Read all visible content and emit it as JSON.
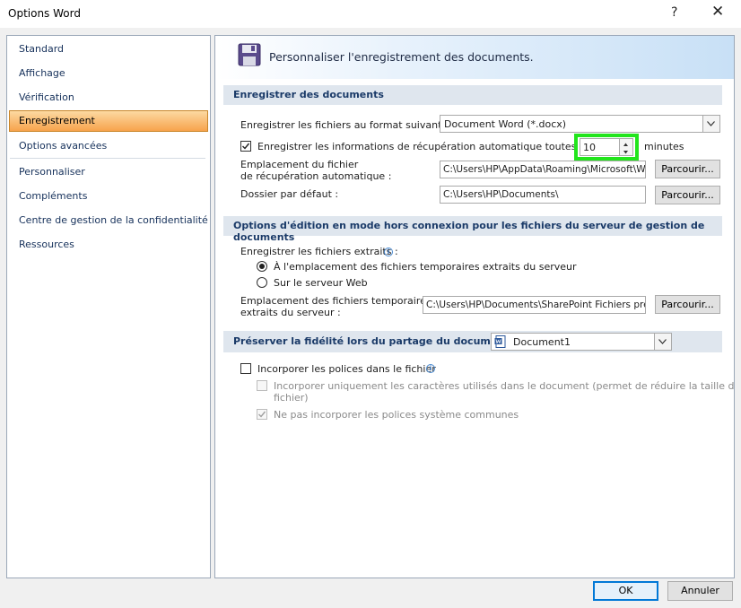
{
  "window": {
    "title": "Options Word",
    "help_glyph": "?",
    "close_glyph": "✕"
  },
  "sidebar": {
    "items": [
      {
        "label": "Standard"
      },
      {
        "label": "Affichage"
      },
      {
        "label": "Vérification"
      },
      {
        "label": "Enregistrement",
        "selected": true
      },
      {
        "label": "Options avancées"
      },
      {
        "label": "Personnaliser"
      },
      {
        "label": "Compléments"
      },
      {
        "label": "Centre de gestion de la confidentialité"
      },
      {
        "label": "Ressources"
      }
    ]
  },
  "banner": {
    "title": "Personnaliser l'enregistrement des documents.",
    "icon": "floppy-disk-icon"
  },
  "save_section": {
    "header": "Enregistrer des documents",
    "format_label": "Enregistrer les fichiers au format suivant :",
    "format_value": "Document Word (*.docx)",
    "autorecover_label": "Enregistrer les informations de récupération automatique toutes les",
    "autorecover_checked": true,
    "autorecover_minutes": "10",
    "minutes_label": "minutes",
    "autorecover_location_label_1": "Emplacement du fichier",
    "autorecover_location_label_2": "de récupération automatique :",
    "autorecover_location_value": "C:\\Users\\HP\\AppData\\Roaming\\Microsoft\\W",
    "default_folder_label": "Dossier par défaut :",
    "default_folder_value": "C:\\Users\\HP\\Documents\\",
    "browse_label": "Parcourir..."
  },
  "offline_section": {
    "header": "Options d'édition en mode hors connexion pour les fichiers du serveur de gestion de documents",
    "save_checked_out_label": "Enregistrer les fichiers extraits :",
    "option_local": "À l'emplacement des fichiers temporaires extraits du serveur",
    "option_web": "Sur le serveur Web",
    "selected_option": "local",
    "drafts_label_1": "Emplacement des fichiers temporaires",
    "drafts_label_2": "extraits du serveur :",
    "drafts_value": "C:\\Users\\HP\\Documents\\SharePoint Fichiers pré",
    "browse_label": "Parcourir..."
  },
  "fidelity_section": {
    "header": "Préserver la fidélité lors du partage du document :",
    "document_value": "Document1",
    "embed_fonts_label": "Incorporer les polices dans le fichier",
    "embed_fonts_checked": false,
    "embed_used_chars_label_1": "Incorporer uniquement les caractères utilisés dans le document (permet de réduire la taille de",
    "embed_used_chars_label_2": "fichier)",
    "no_system_fonts_label": "Ne pas incorporer les polices système communes"
  },
  "footer": {
    "ok_label": "OK",
    "cancel_label": "Annuler"
  },
  "colors": {
    "selected_nav": "#f7a34c",
    "highlight_box": "#22e51c",
    "section_header": "#dfe6ee"
  }
}
